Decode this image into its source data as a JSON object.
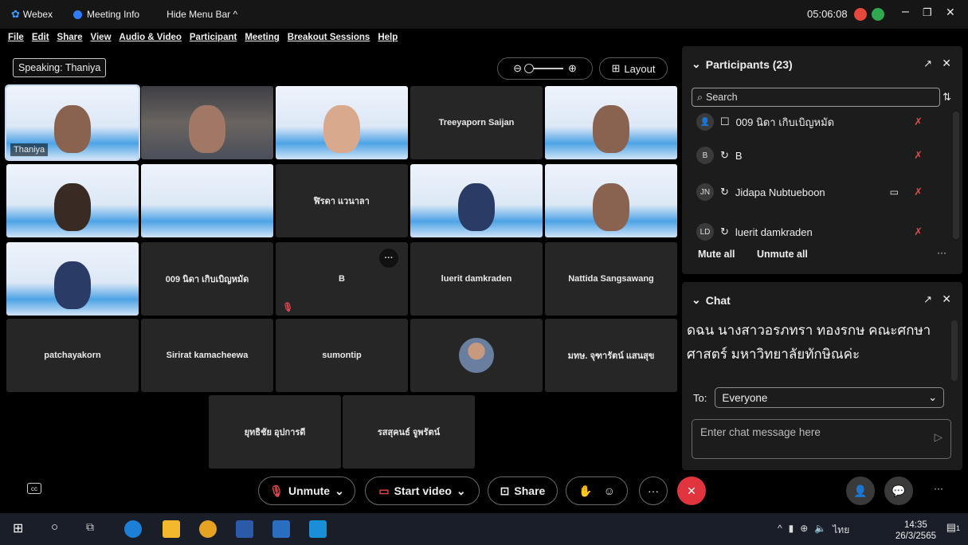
{
  "titlebar": {
    "app": "Webex",
    "meeting_info": "Meeting Info",
    "hide_menu": "Hide Menu Bar ^",
    "clock": "05:06:08"
  },
  "menubar": [
    "File",
    "Edit",
    "Share",
    "View",
    "Audio & Video",
    "Participant",
    "Meeting",
    "Breakout Sessions",
    "Help"
  ],
  "stage": {
    "speaking_label": "Speaking: Thaniya",
    "layout_label": "Layout",
    "tiles": [
      {
        "name": "",
        "caption": "Thaniya",
        "video": true
      },
      {
        "name": "",
        "video": true,
        "dark": true
      },
      {
        "name": "",
        "video": true
      },
      {
        "name": "Treeyaporn Saijan"
      },
      {
        "name": "",
        "video": true
      },
      {
        "name": "",
        "video": true
      },
      {
        "name": "",
        "video": true
      },
      {
        "name": "ฬิรดา แวนาลา"
      },
      {
        "name": "",
        "video": true
      },
      {
        "name": "",
        "video": true
      },
      {
        "name": "",
        "video": true
      },
      {
        "name": "009 นิดา เกิบเบิญหมัด"
      },
      {
        "name": "B"
      },
      {
        "name": "luerit damkraden"
      },
      {
        "name": "Nattida Sangsawang"
      },
      {
        "name": "patchayakorn"
      },
      {
        "name": "Sirirat kamacheewa"
      },
      {
        "name": "sumontip"
      },
      {
        "name": ""
      },
      {
        "name": "มทษ. จุฑารัตน์ แสนสุข"
      },
      {
        "name": "ยุทธิชัย อุปการดี"
      },
      {
        "name": "รสสุคนธ์ จูพรัตน์"
      }
    ]
  },
  "controls": {
    "unmute": "Unmute",
    "start_video": "Start video",
    "share": "Share"
  },
  "participants": {
    "title": "Participants (23)",
    "search_placeholder": "Search",
    "rows": [
      {
        "initials": "",
        "name": "009 นิดา เกิบเบิญหมัด"
      },
      {
        "initials": "B",
        "name": "B"
      },
      {
        "initials": "JN",
        "name": "Jidapa Nubtueboon"
      },
      {
        "initials": "LD",
        "name": "luerit damkraden"
      }
    ],
    "mute_all": "Mute all",
    "unmute_all": "Unmute all"
  },
  "chat": {
    "title": "Chat",
    "message": "ดฉน นางสาวอรภทรา ทองรกษ คณะศกษาศาสตร์ มหาวิทยาลัยทักษิณค่ะ",
    "to_label": "To:",
    "to_value": "Everyone",
    "input_placeholder": "Enter chat message here"
  },
  "taskbar": {
    "lang": "ไทย",
    "time": "14:35",
    "date": "26/3/2565",
    "notif": "1"
  }
}
